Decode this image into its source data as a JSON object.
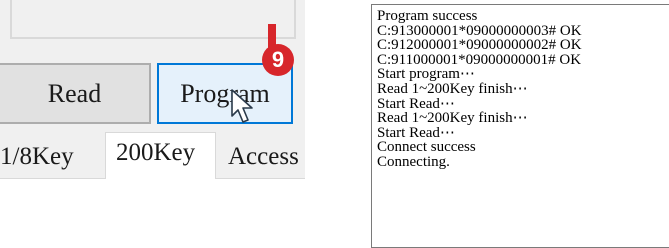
{
  "buttons": {
    "read_label": "Read",
    "program_label": "Program"
  },
  "badge": {
    "number": "9",
    "color": "#d7262b"
  },
  "tabs": [
    {
      "label": "1/8Key",
      "selected": false
    },
    {
      "label": "200Key",
      "selected": true
    },
    {
      "label": "Access",
      "selected": false
    }
  ],
  "log": {
    "lines": [
      "Program success",
      "C:913000001*09000000003# OK",
      "C:912000001*09000000002# OK",
      "C:911000001*09000000001# OK",
      "Start program⋯",
      "Read 1~200Key finish⋯",
      "Start Read⋯",
      "Read 1~200Key finish⋯",
      "Start Read⋯",
      "Connect success",
      "Connecting."
    ]
  },
  "icons": {
    "cursor": "mouse-pointer-icon"
  },
  "colors": {
    "program_button_border": "#0078d7",
    "program_button_bg": "#e5f1fb",
    "read_button_bg": "#e1e1e1"
  }
}
